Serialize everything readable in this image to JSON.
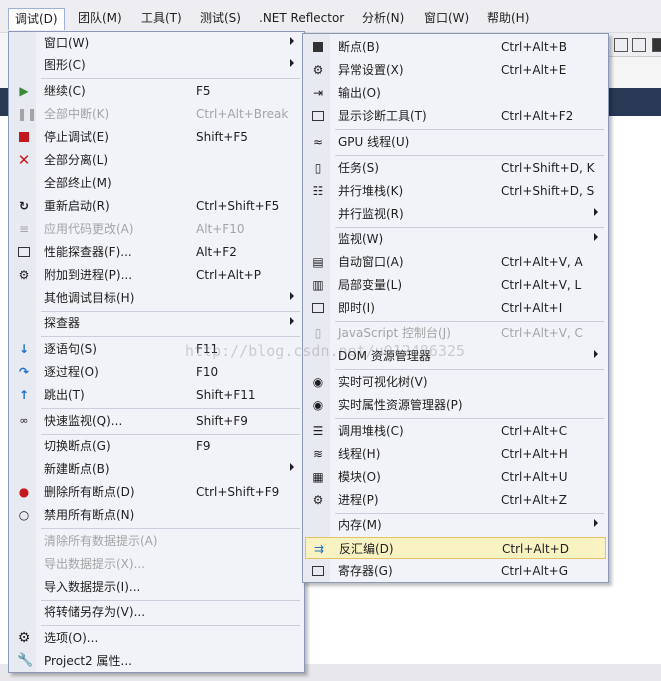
{
  "menubar": [
    "调试(D)",
    "团队(M)",
    "工具(T)",
    "测试(S)",
    ".NET Reflector",
    "分析(N)",
    "窗口(W)",
    "帮助(H)"
  ],
  "debug_menu": [
    {
      "label": "窗口(W)",
      "shortcut": "",
      "icon": "",
      "submenu": true,
      "disabled": false
    },
    {
      "label": "图形(C)",
      "shortcut": "",
      "icon": "",
      "submenu": true,
      "disabled": false
    },
    {
      "label": "继续(C)",
      "shortcut": "F5",
      "icon": "play-icon",
      "disabled": false
    },
    {
      "label": "全部中断(K)",
      "shortcut": "Ctrl+Alt+Break",
      "icon": "pause-icon",
      "disabled": true
    },
    {
      "label": "停止调试(E)",
      "shortcut": "Shift+F5",
      "icon": "stop-icon",
      "disabled": false
    },
    {
      "label": "全部分离(L)",
      "shortcut": "",
      "icon": "detach-icon",
      "disabled": false
    },
    {
      "label": "全部终止(M)",
      "shortcut": "",
      "icon": "",
      "disabled": false
    },
    {
      "label": "重新启动(R)",
      "shortcut": "Ctrl+Shift+F5",
      "icon": "restart-icon",
      "disabled": false
    },
    {
      "label": "应用代码更改(A)",
      "shortcut": "Alt+F10",
      "icon": "apply-changes-icon",
      "disabled": true
    },
    {
      "label": "性能探查器(F)...",
      "shortcut": "Alt+F2",
      "icon": "profiler-icon",
      "disabled": false
    },
    {
      "label": "附加到进程(P)...",
      "shortcut": "Ctrl+Alt+P",
      "icon": "attach-icon",
      "disabled": false
    },
    {
      "label": "其他调试目标(H)",
      "shortcut": "",
      "icon": "",
      "submenu": true,
      "disabled": false
    },
    {
      "label": "探查器",
      "shortcut": "",
      "icon": "",
      "submenu": true,
      "disabled": false
    },
    {
      "label": "逐语句(S)",
      "shortcut": "F11",
      "icon": "step-into-icon",
      "disabled": false
    },
    {
      "label": "逐过程(O)",
      "shortcut": "F10",
      "icon": "step-over-icon",
      "disabled": false
    },
    {
      "label": "跳出(T)",
      "shortcut": "Shift+F11",
      "icon": "step-out-icon",
      "disabled": false
    },
    {
      "label": "快速监视(Q)...",
      "shortcut": "Shift+F9",
      "icon": "quickwatch-icon",
      "disabled": false
    },
    {
      "label": "切换断点(G)",
      "shortcut": "F9",
      "icon": "",
      "disabled": false
    },
    {
      "label": "新建断点(B)",
      "shortcut": "",
      "icon": "",
      "submenu": true,
      "disabled": false
    },
    {
      "label": "删除所有断点(D)",
      "shortcut": "Ctrl+Shift+F9",
      "icon": "delete-breakpoints-icon",
      "disabled": false
    },
    {
      "label": "禁用所有断点(N)",
      "shortcut": "",
      "icon": "disable-breakpoints-icon",
      "disabled": false
    },
    {
      "label": "清除所有数据提示(A)",
      "shortcut": "",
      "icon": "",
      "disabled": true
    },
    {
      "label": "导出数据提示(X)...",
      "shortcut": "",
      "icon": "",
      "disabled": true
    },
    {
      "label": "导入数据提示(I)...",
      "shortcut": "",
      "icon": "",
      "disabled": false
    },
    {
      "label": "将转储另存为(V)...",
      "shortcut": "",
      "icon": "",
      "disabled": false
    },
    {
      "label": "选项(O)...",
      "shortcut": "",
      "icon": "gear-icon",
      "disabled": false
    },
    {
      "label": "Project2 属性...",
      "shortcut": "",
      "icon": "wrench-icon",
      "disabled": false
    }
  ],
  "window_submenu": [
    {
      "label": "断点(B)",
      "shortcut": "Ctrl+Alt+B",
      "icon": "breakpoints-window-icon"
    },
    {
      "label": "异常设置(X)",
      "shortcut": "Ctrl+Alt+E",
      "icon": "exception-settings-icon"
    },
    {
      "label": "输出(O)",
      "shortcut": "",
      "icon": "output-icon"
    },
    {
      "label": "显示诊断工具(T)",
      "shortcut": "Ctrl+Alt+F2",
      "icon": "diagnostic-tools-icon"
    },
    {
      "label": "GPU 线程(U)",
      "shortcut": "",
      "icon": "gpu-threads-icon"
    },
    {
      "label": "任务(S)",
      "shortcut": "Ctrl+Shift+D, K",
      "icon": "tasks-icon"
    },
    {
      "label": "并行堆栈(K)",
      "shortcut": "Ctrl+Shift+D, S",
      "icon": "parallel-stacks-icon"
    },
    {
      "label": "并行监视(R)",
      "shortcut": "",
      "icon": "",
      "submenu": true
    },
    {
      "label": "监视(W)",
      "shortcut": "",
      "icon": "",
      "submenu": true
    },
    {
      "label": "自动窗口(A)",
      "shortcut": "Ctrl+Alt+V, A",
      "icon": "autos-icon"
    },
    {
      "label": "局部变量(L)",
      "shortcut": "Ctrl+Alt+V, L",
      "icon": "locals-icon"
    },
    {
      "label": "即时(I)",
      "shortcut": "Ctrl+Alt+I",
      "icon": "immediate-icon"
    },
    {
      "label": "JavaScript 控制台(J)",
      "shortcut": "Ctrl+Alt+V, C",
      "icon": "js-console-icon",
      "disabled": true
    },
    {
      "label": "DOM 资源管理器",
      "shortcut": "",
      "icon": "",
      "submenu": true
    },
    {
      "label": "实时可视化树(V)",
      "shortcut": "",
      "icon": "live-visual-tree-icon"
    },
    {
      "label": "实时属性资源管理器(P)",
      "shortcut": "",
      "icon": "live-property-explorer-icon"
    },
    {
      "label": "调用堆栈(C)",
      "shortcut": "Ctrl+Alt+C",
      "icon": "call-stack-icon"
    },
    {
      "label": "线程(H)",
      "shortcut": "Ctrl+Alt+H",
      "icon": "threads-icon"
    },
    {
      "label": "模块(O)",
      "shortcut": "Ctrl+Alt+U",
      "icon": "modules-icon"
    },
    {
      "label": "进程(P)",
      "shortcut": "Ctrl+Alt+Z",
      "icon": "processes-icon"
    },
    {
      "label": "内存(M)",
      "shortcut": "",
      "icon": "",
      "submenu": true
    },
    {
      "label": "反汇编(D)",
      "shortcut": "Ctrl+Alt+D",
      "icon": "disassembly-icon",
      "highlighted": true
    },
    {
      "label": "寄存器(G)",
      "shortcut": "Ctrl+Alt+G",
      "icon": "registers-icon"
    }
  ],
  "watermark": "http://blog.csdn.net/u012486325"
}
